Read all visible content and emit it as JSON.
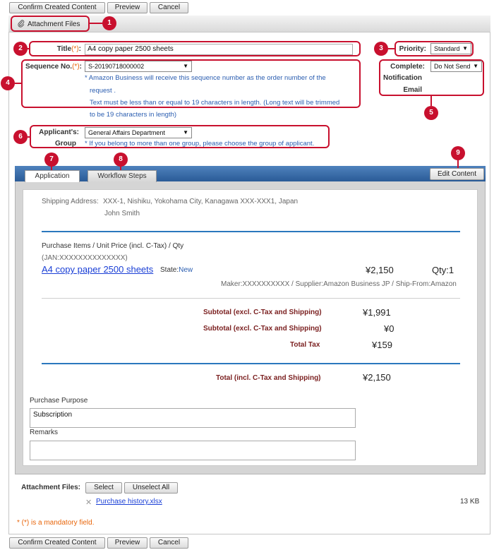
{
  "toolbar": {
    "confirm_label": "Confirm Created Content",
    "preview_label": "Preview",
    "cancel_label": "Cancel"
  },
  "attachment_bar": {
    "label": "Attachment Files"
  },
  "callouts": [
    "1",
    "2",
    "3",
    "4",
    "5",
    "6",
    "7",
    "8",
    "9"
  ],
  "form": {
    "title_label": "Title",
    "required_mark": "(*)",
    "title_value": "A4 copy paper 2500 sheets",
    "priority_label": "Priority",
    "priority_value": "Standard",
    "sequence_label": "Sequence No.",
    "sequence_value": "S-20190718000002",
    "sequence_note_1": "* Amazon Business will receive this sequence number as the order number of the",
    "sequence_note_2": "request .",
    "sequence_note_3": "Text must be less than or equal to 19 characters in length. (Long text will be trimmed",
    "sequence_note_4": "to be 19 characters in length)",
    "complete_label_1": "Complete",
    "complete_label_2": "Notification",
    "complete_label_3": "Email",
    "complete_value": "Do Not Send",
    "group_label_1": "Applicant's",
    "group_label_2": "Group",
    "group_value": "General Affairs Department",
    "group_note": "* If you belong to more than one group, please choose the group of applicant.",
    "colon": ":"
  },
  "tabs": {
    "application": "Application",
    "workflow": "Workflow Steps",
    "edit_content": "Edit Content"
  },
  "content": {
    "shipping_label": "Shipping Address:",
    "shipping_address": "XXX-1, Nishiku, Yokohama City, Kanagawa XXX-XXX1, Japan",
    "shipping_name": "John Smith",
    "items_header": "Purchase Items / Unit Price (incl. C-Tax) / Qty",
    "jan": "(JAN:XXXXXXXXXXXXXX)",
    "item_name": "A4 copy paper 2500 sheets",
    "state_label": "State:",
    "state_value": "New",
    "item_price": "¥2,150",
    "item_qty": "Qty:1",
    "maker_line": "Maker:XXXXXXXXXX / Supplier:Amazon Business JP / Ship-From:Amazon",
    "subtotal_label": "Subtotal (excl. C-Tax and Shipping)",
    "subtotal_value": "¥1,991",
    "subtotal2_label": "Subtotal (excl. C-Tax and Shipping)",
    "subtotal2_value": "¥0",
    "tax_label": "Total Tax",
    "tax_value": "¥159",
    "total_label": "Total (incl. C-Tax and Shipping)",
    "total_value": "¥2,150",
    "purpose_label": "Purchase Purpose",
    "purpose_value": "Subscription",
    "remarks_label": "Remarks",
    "remarks_value": ""
  },
  "attachments": {
    "label": "Attachment Files",
    "select_label": "Select",
    "unselect_label": "Unselect All",
    "file_name": "Purchase history.xlsx",
    "file_size": "13 KB"
  },
  "footer": {
    "mandatory_note": "* (*) is a mandatory field."
  },
  "colors": {
    "callout_red": "#c8102e",
    "tab_blue": "#2a5b97",
    "link_blue": "#1a3fd6",
    "note_blue": "#2a5db0",
    "total_red": "#7a1f1f",
    "required_orange": "#e8650a"
  }
}
